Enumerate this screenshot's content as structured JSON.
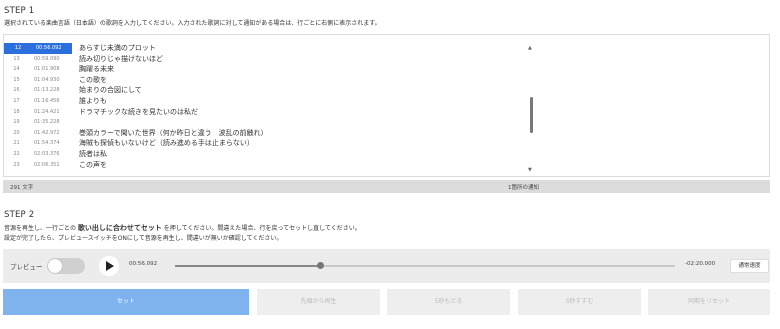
{
  "step1": {
    "title": "STEP 1",
    "description": "選択されている楽曲言語（日本語）の歌詞を入力してください。入力された歌詞に対して通知がある場合は、行ごとに右側に表示されます。"
  },
  "lyrics": {
    "rows": [
      {
        "num": "12",
        "time": "00:56.092",
        "text": "あらすじ未満のプロット",
        "active": true
      },
      {
        "num": "13",
        "time": "00:59.090",
        "text": "読み切りじゃ描けないほど"
      },
      {
        "num": "14",
        "time": "01:01.908",
        "text": "胸躍る未来"
      },
      {
        "num": "15",
        "time": "01:04.930",
        "text": "この歌を"
      },
      {
        "num": "16",
        "time": "01:13.228",
        "text": "始まりの合図にして"
      },
      {
        "num": "17",
        "time": "01:16.456",
        "text": "誰よりも"
      },
      {
        "num": "18",
        "time": "01:24.421",
        "text": "ドラマチックな続きを見たいのは私だ"
      },
      {
        "num": "19",
        "time": "01:35.228",
        "text": ""
      },
      {
        "num": "20",
        "time": "01:42.972",
        "text": "巻頭カラーで聞いた世界（何か昨日と違う　波乱の前触れ）"
      },
      {
        "num": "21",
        "time": "01:54.374",
        "text": "海賊も探偵もいないけど（読み進める手は止まらない）"
      },
      {
        "num": "22",
        "time": "02:03.376",
        "text": "読者は私"
      },
      {
        "num": "23",
        "time": "02:06.351",
        "text": "この声を"
      }
    ]
  },
  "status": {
    "char_count": "291 文字",
    "notice": "1箇所の通知"
  },
  "step2": {
    "title": "STEP 2",
    "line1_pre": "音源を再生し、一行ごとの",
    "line1_bold": "歌い出しに合わせてセット",
    "line1_post": "を押してください。間違えた場合、行を戻ってセットし直してください。",
    "line2": "設定が完了したら、プレビュースイッチをONにして音源を再生し、間違いが無いか確認してください。"
  },
  "player": {
    "preview_label": "プレビュー",
    "current_time": "00:56.092",
    "remaining_time": "-02:20.000",
    "progress": 0.29,
    "speed_label": "通常速度"
  },
  "actions": {
    "set": "セット",
    "play_from_start": "先頭から再生",
    "back_5s": "5秒もどる",
    "forward_5s": "5秒すすむ",
    "reset_sync": "同期をリセット"
  },
  "colors": {
    "active_row": "#2a6fdb",
    "primary_button": "#7fb3ee"
  }
}
